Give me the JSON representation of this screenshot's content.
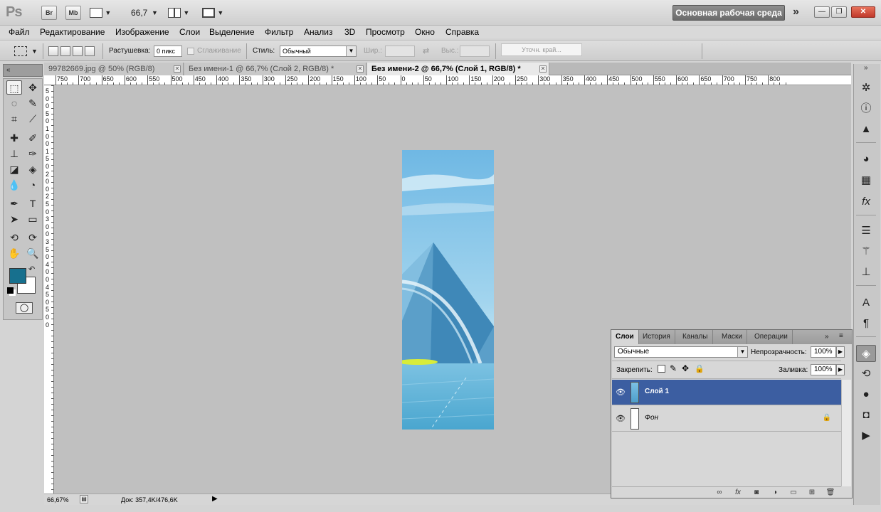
{
  "app": {
    "logo": "Ps",
    "bridge_label": "Br",
    "minibridge_label": "Mb",
    "zoom": "66,7",
    "workspace": "Основная рабочая среда",
    "min_label": "—",
    "restore_label": "❐",
    "close_label": "✕"
  },
  "menu": [
    "Файл",
    "Редактирование",
    "Изображение",
    "Слои",
    "Выделение",
    "Фильтр",
    "Анализ",
    "3D",
    "Просмотр",
    "Окно",
    "Справка"
  ],
  "options": {
    "feather_label": "Растушевка:",
    "feather_value": "0 пикс",
    "antialias_label": "Сглаживание",
    "style_label": "Стиль:",
    "style_value": "Обычный",
    "width_label": "Шир.:",
    "height_label": "Выс.:",
    "refine_label": "Уточн. край..."
  },
  "tabs": [
    {
      "label": "99782669.jpg @ 50% (RGB/8)",
      "active": false
    },
    {
      "label": "Без имени-1 @ 66,7% (Слой 2, RGB/8) *",
      "active": false
    },
    {
      "label": "Без имени-2 @ 66,7% (Слой 1, RGB/8) *",
      "active": true
    }
  ],
  "ruler_top": [
    "750",
    "700",
    "650",
    "600",
    "550",
    "500",
    "450",
    "400",
    "350",
    "300",
    "250",
    "200",
    "150",
    "100",
    "50",
    "0",
    "50",
    "100",
    "150",
    "200",
    "250",
    "300",
    "350",
    "400",
    "450",
    "500",
    "550",
    "600",
    "650",
    "700",
    "750",
    "800"
  ],
  "ruler_left": [
    "5",
    "0",
    "0",
    "5",
    "0",
    "1",
    "0",
    "0",
    "1",
    "5",
    "0",
    "2",
    "0",
    "0",
    "2",
    "5",
    "0",
    "3",
    "0",
    "0",
    "3",
    "5",
    "0",
    "4",
    "0",
    "0",
    "4",
    "5",
    "0",
    "5",
    "0",
    "0"
  ],
  "status": {
    "zoom": "66,67%",
    "doc": "Док: 357,4K/476,6K"
  },
  "layers_panel": {
    "tabs": [
      "Слои",
      "История",
      "Каналы",
      "Маски",
      "Операции"
    ],
    "blend_mode": "Обычные",
    "opacity_label": "Непрозрачность:",
    "opacity_value": "100%",
    "lock_label": "Закрепить:",
    "fill_label": "Заливка:",
    "fill_value": "100%",
    "layers": [
      {
        "name": "Слой 1",
        "selected": true,
        "locked": false
      },
      {
        "name": "Фон",
        "selected": false,
        "locked": true
      }
    ]
  },
  "colors": {
    "foreground": "#17708e",
    "background": "#ffffff",
    "selection": "#3c5ea1",
    "canvas": "#c0c0c0"
  }
}
